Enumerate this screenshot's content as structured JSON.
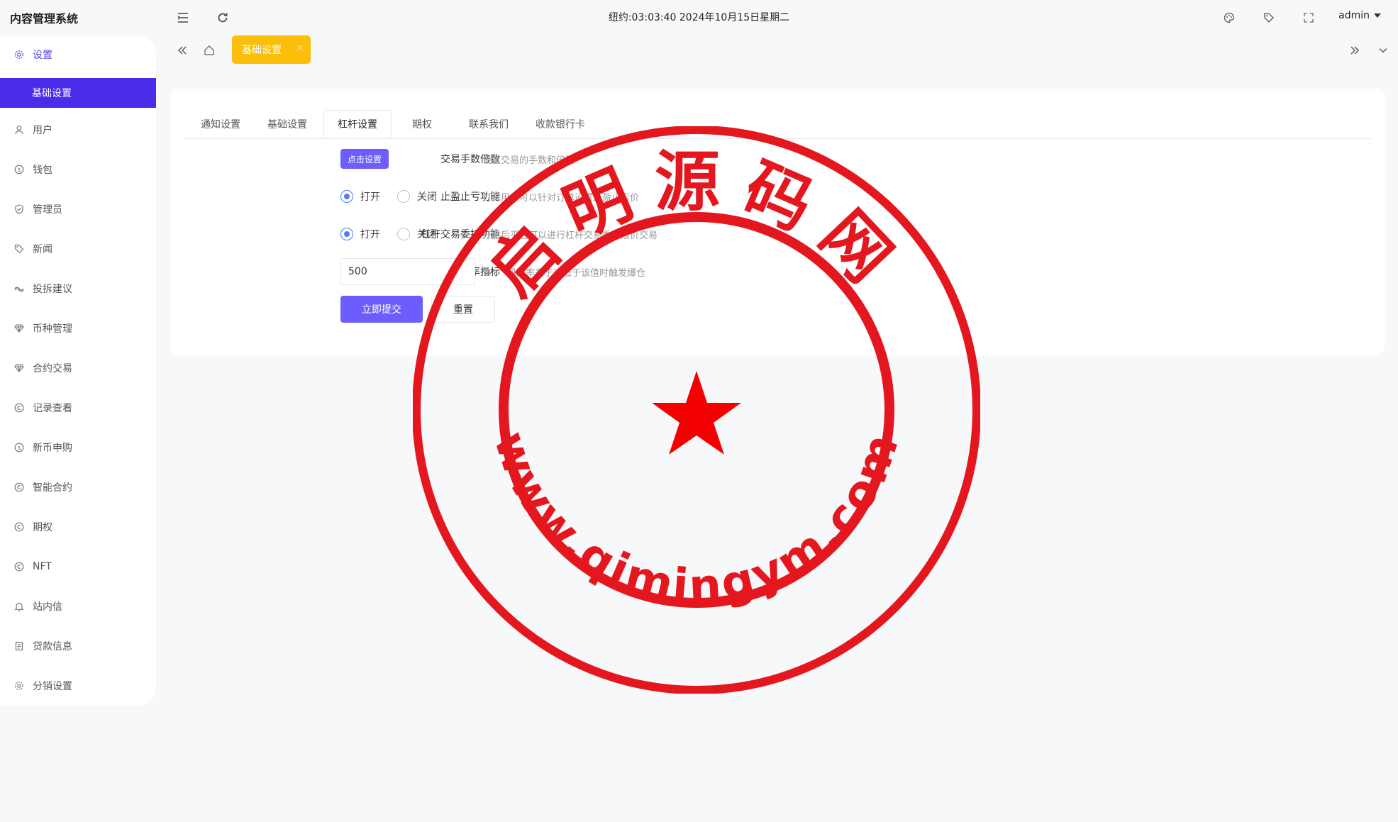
{
  "header": {
    "brand": "内容管理系统",
    "clock": "纽约:03:03:40 2024年10月15日星期二",
    "user": "admin"
  },
  "sidebar": {
    "items": [
      {
        "label": "设置",
        "icon": "gear-icon"
      },
      {
        "label": "用户",
        "icon": "user-icon"
      },
      {
        "label": "钱包",
        "icon": "coin-icon"
      },
      {
        "label": "管理员",
        "icon": "shield-icon"
      },
      {
        "label": "新闻",
        "icon": "tag-icon"
      },
      {
        "label": "投拆建议",
        "icon": "link-icon"
      },
      {
        "label": "币种管理",
        "icon": "diamond-icon"
      },
      {
        "label": "合约交易",
        "icon": "diamond-icon"
      },
      {
        "label": "记录查看",
        "icon": "circle-c-icon"
      },
      {
        "label": "新币申购",
        "icon": "coin-icon"
      },
      {
        "label": "智能合约",
        "icon": "circle-c-icon"
      },
      {
        "label": "期权",
        "icon": "circle-c-icon"
      },
      {
        "label": "NFT",
        "icon": "circle-c-icon"
      },
      {
        "label": "站内信",
        "icon": "bell-icon"
      },
      {
        "label": "贷款信息",
        "icon": "doc-icon"
      },
      {
        "label": "分销设置",
        "icon": "gear-icon"
      }
    ],
    "sub_active": "基础设置"
  },
  "page_tab": {
    "label": "基础设置"
  },
  "inner_tabs": [
    "通知设置",
    "基础设置",
    "杠杆设置",
    "期权",
    "联系我们",
    "收款银行卡"
  ],
  "form": {
    "fee": {
      "label": "交易手数倍数",
      "button": "点击设置",
      "help": "设置交易的手数和倍数"
    },
    "stop": {
      "label": "止盈止亏功能",
      "on": "打开",
      "off": "关闭",
      "help": "打开用户可以针对订单设置止盈止亏价"
    },
    "entrust": {
      "label": "杠杆交易委托功能",
      "on": "打开",
      "off": "关闭",
      "help": "开启后平台可以进行杠杆交易委托限价交易"
    },
    "risk": {
      "label": "爆仓风险率指标",
      "value": "500",
      "unit": "%",
      "help": "风险率高于或低于该值时触发爆仓"
    },
    "submit": "立即提交",
    "reset": "重置"
  },
  "watermark": {
    "top_text": "启明源码网",
    "bottom_text": "www.qimingym.com",
    "color": "#e4161e"
  }
}
